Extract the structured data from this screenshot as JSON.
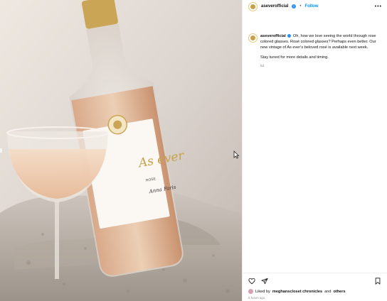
{
  "post": {
    "username": "aseverofficial",
    "dot": "•",
    "follow_label": "Follow",
    "more_label": "•••",
    "caption_part1": "Oh, how we love seeing the world through rose colored glasses. Rosé colored glasses? Perhaps even better. Our new vintage of As ever's beloved rosé is available next week.",
    "caption_part2": "Stay tuned for more details and timing.",
    "caption_age": "5d",
    "liked_by_prefix": "Liked by",
    "liked_by_user": "meghanscloset chronicles",
    "liked_by_and": "and",
    "liked_by_others": "others",
    "posted_when": "5 hours ago"
  },
  "label_on_bottle": {
    "brand_script": "As ever",
    "variety": "ROSE",
    "signature": "Anna Faris"
  },
  "icons": {
    "heart": "heart-icon",
    "share": "send-icon",
    "save": "bookmark-icon",
    "verified": "verified-badge-icon"
  }
}
